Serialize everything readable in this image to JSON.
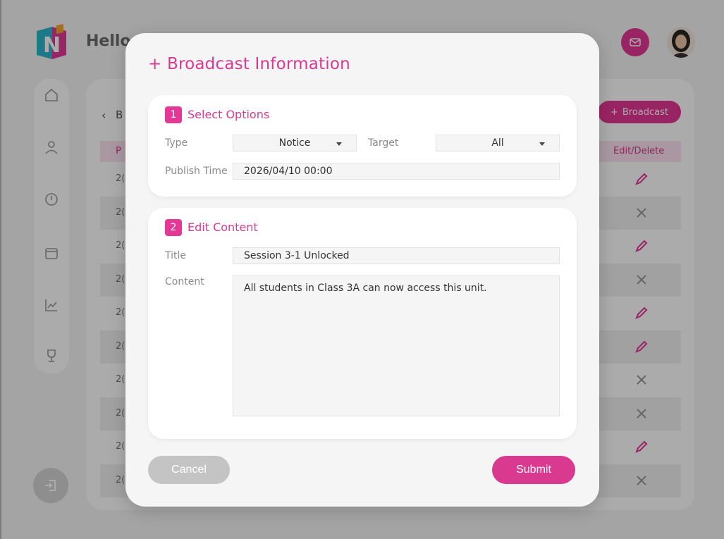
{
  "background": {
    "greeting": "Hello,",
    "breadcrumb_text": "B",
    "broadcast_button_label": "Broadcast",
    "table_header_left": "P",
    "table_header_right": "Edit/Delete",
    "rows": [
      {
        "num": "2(",
        "action": "edit"
      },
      {
        "num": "2(",
        "action": "delete"
      },
      {
        "num": "2(",
        "action": "edit"
      },
      {
        "num": "2(",
        "action": "delete"
      },
      {
        "num": "2(",
        "action": "edit"
      },
      {
        "num": "2(",
        "action": "edit"
      },
      {
        "num": "2(",
        "action": "delete"
      },
      {
        "num": "2(",
        "action": "delete"
      },
      {
        "num": "2(",
        "action": "edit"
      },
      {
        "num": "2(",
        "action": "delete"
      }
    ],
    "sidebar_icons": [
      "home-icon",
      "user-icon",
      "alert-icon",
      "calendar-icon",
      "chart-icon",
      "trophy-icon"
    ]
  },
  "modal": {
    "title": "+ Broadcast Information",
    "section1": {
      "number": "1",
      "heading": "Select Options",
      "type_label": "Type",
      "type_value": "Notice",
      "target_label": "Target",
      "target_value": "All",
      "publish_label": "Publish Time",
      "publish_value": "2026/04/10 00:00"
    },
    "section2": {
      "number": "2",
      "heading": "Edit Content",
      "title_label": "Title",
      "title_value": "Session 3-1 Unlocked",
      "content_label": "Content",
      "content_value": "All students in Class 3A can now access this unit."
    },
    "cancel_label": "Cancel",
    "submit_label": "Submit"
  },
  "colors": {
    "accent": "#d9398f",
    "accent_bright": "#e43796",
    "cancel_gray": "#c4c4c4"
  }
}
